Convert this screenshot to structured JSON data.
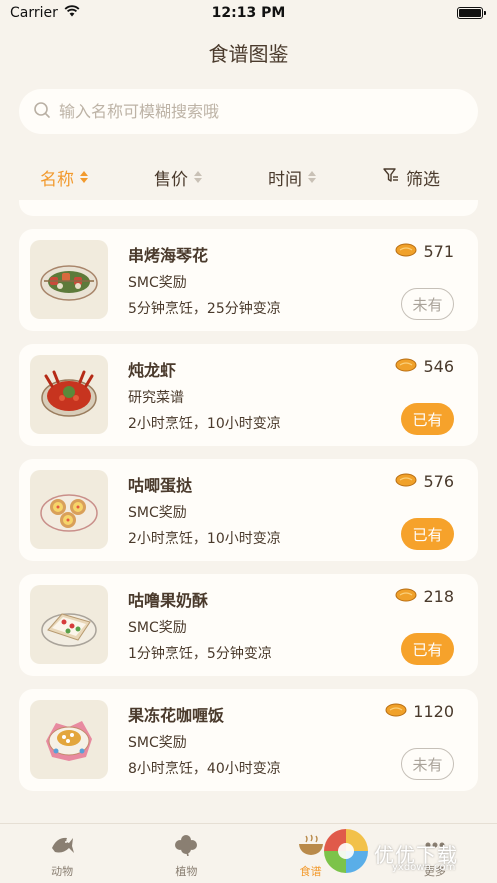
{
  "status_bar": {
    "carrier": "Carrier",
    "time": "12:13 PM"
  },
  "nav": {
    "title": "食谱图鉴"
  },
  "search": {
    "placeholder": "输入名称可模糊搜索哦",
    "value": ""
  },
  "sort": {
    "items": [
      {
        "label": "名称",
        "active": true
      },
      {
        "label": "售价",
        "active": false
      },
      {
        "label": "时间",
        "active": false
      }
    ],
    "filter_label": "筛选"
  },
  "recipes": [
    {
      "name": "串烤海琴花",
      "source": "SMC奖励",
      "time": "5分钟烹饪，25分钟变凉",
      "price": "571",
      "status": "未有",
      "owned": false,
      "icon": "skewer-dish-icon"
    },
    {
      "name": "炖龙虾",
      "source": "研究菜谱",
      "time": "2小时烹饪，10小时变凉",
      "price": "546",
      "status": "已有",
      "owned": true,
      "icon": "lobster-dish-icon"
    },
    {
      "name": "咕唧蛋挞",
      "source": "SMC奖励",
      "time": "2小时烹饪，10小时变凉",
      "price": "576",
      "status": "已有",
      "owned": true,
      "icon": "egg-tart-icon"
    },
    {
      "name": "咕噜果奶酥",
      "source": "SMC奖励",
      "time": "1分钟烹饪，5分钟变凉",
      "price": "218",
      "status": "已有",
      "owned": true,
      "icon": "fruit-pastry-icon"
    },
    {
      "name": "果冻花咖喱饭",
      "source": "SMC奖励",
      "time": "8小时烹饪，40小时变凉",
      "price": "1120",
      "status": "未有",
      "owned": false,
      "icon": "curry-rice-icon"
    }
  ],
  "tabs": [
    {
      "label": "动物",
      "active": false,
      "icon": "fish-icon"
    },
    {
      "label": "植物",
      "active": false,
      "icon": "clover-icon"
    },
    {
      "label": "食谱",
      "active": true,
      "icon": "bowl-icon"
    },
    {
      "label": "更多",
      "active": false,
      "icon": "more-icon"
    }
  ],
  "watermark": {
    "text": "优优下载",
    "sub": "yxdown.com"
  },
  "colors": {
    "accent": "#f29a2e",
    "owned_badge": "#f6a22b",
    "background": "#f7f3ec",
    "card": "#fffdf9"
  }
}
